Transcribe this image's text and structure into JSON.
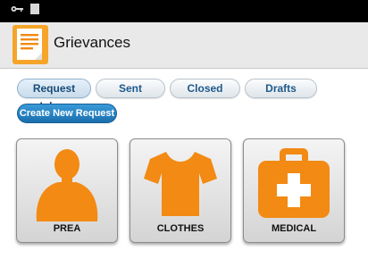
{
  "app": {
    "title": "Grievances",
    "icon": "notepad-icon"
  },
  "status_bar": {
    "icons": [
      "key-icon",
      "sd-card-icon"
    ]
  },
  "tabs": [
    {
      "label": "Request Inbox",
      "active": true
    },
    {
      "label": "Sent",
      "active": false
    },
    {
      "label": "Closed",
      "active": false
    },
    {
      "label": "Drafts",
      "active": false
    }
  ],
  "actions": {
    "create_label": "Create New Request"
  },
  "categories": [
    {
      "label": "PREA",
      "icon": "person-icon"
    },
    {
      "label": "CLOTHES",
      "icon": "tshirt-icon"
    },
    {
      "label": "MEDICAL",
      "icon": "medical-kit-icon"
    }
  ],
  "colors": {
    "accent_orange": "#f28a14",
    "button_blue": "#1f7bbf",
    "tab_text": "#1d5a8c"
  }
}
